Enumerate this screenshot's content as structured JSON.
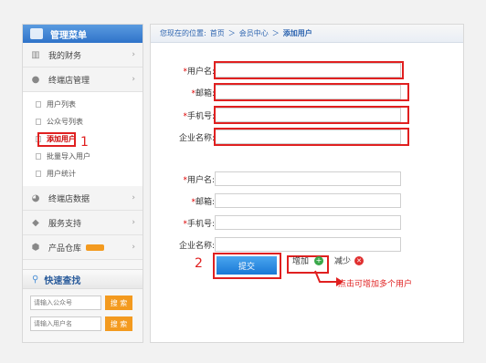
{
  "sidebar": {
    "title": "管理菜单",
    "items": [
      {
        "label": "我的财务",
        "icon": "chart-icon"
      },
      {
        "label": "终端店管理",
        "icon": "user-icon"
      }
    ],
    "sub": [
      "用户列表",
      "公众号列表",
      "添加用户",
      "批量导入用户",
      "用户统计"
    ],
    "items2": [
      {
        "label": "终端店数据",
        "icon": "pie-icon"
      },
      {
        "label": "服务支持",
        "icon": "tag-icon"
      },
      {
        "label": "产品仓库",
        "icon": "box-icon"
      }
    ],
    "quick": {
      "title": "快速查找",
      "ph1": "请输入公众号",
      "ph2": "请输入用户名",
      "btn": "搜 索"
    }
  },
  "crumb": [
    "您现在的位置:",
    "首页",
    "＞",
    "会员中心",
    "＞",
    "添加用户"
  ],
  "form1": [
    {
      "label": "用户名:",
      "req": "*"
    },
    {
      "label": "邮箱:",
      "req": "*"
    },
    {
      "label": "手机号:",
      "req": "*"
    },
    {
      "label": "企业名称:",
      "req": ""
    }
  ],
  "form2": [
    {
      "label": "用户名:",
      "req": "*"
    },
    {
      "label": "邮箱:",
      "req": "*"
    },
    {
      "label": "手机号:",
      "req": "*"
    },
    {
      "label": "企业名称:",
      "req": ""
    }
  ],
  "submit": "提交",
  "add": "增加",
  "reduce": "减少",
  "annot": {
    "n1": "1",
    "n2": "2",
    "hint": "点击可增加多个用户"
  }
}
